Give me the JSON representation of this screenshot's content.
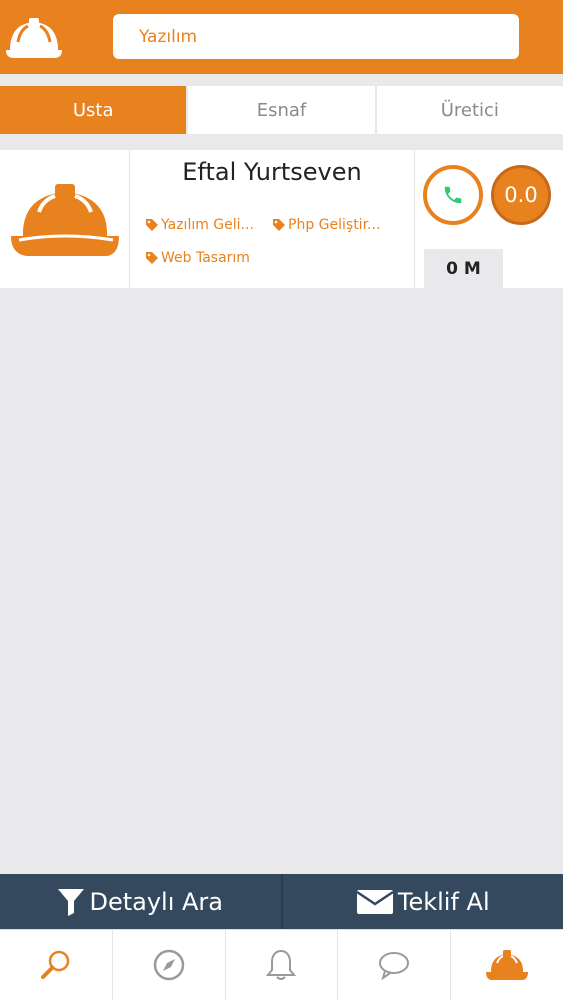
{
  "header": {
    "logo_icon": "helmet-logo-icon",
    "search_value": "Yazılım"
  },
  "tabs": [
    {
      "label": "Usta",
      "active": true
    },
    {
      "label": "Esnaf",
      "active": false
    },
    {
      "label": "Üretici",
      "active": false
    }
  ],
  "results": [
    {
      "name": "Eftal Yurtseven",
      "tags": [
        "Yazılım Geli...",
        "Php Geliştir...",
        "Web Tasarım"
      ],
      "rating": "0.0",
      "distance": "0 M"
    }
  ],
  "actions": {
    "detailed_search": "Detaylı Ara",
    "get_offer": "Teklif Al"
  },
  "tabbar": [
    "search-icon",
    "compass-icon",
    "bell-icon",
    "chat-icon",
    "helmet-icon"
  ],
  "colors": {
    "accent": "#e8821e",
    "dark_bar": "#34495e",
    "background": "#e9e9ec",
    "phone_green": "#2ecc71"
  }
}
